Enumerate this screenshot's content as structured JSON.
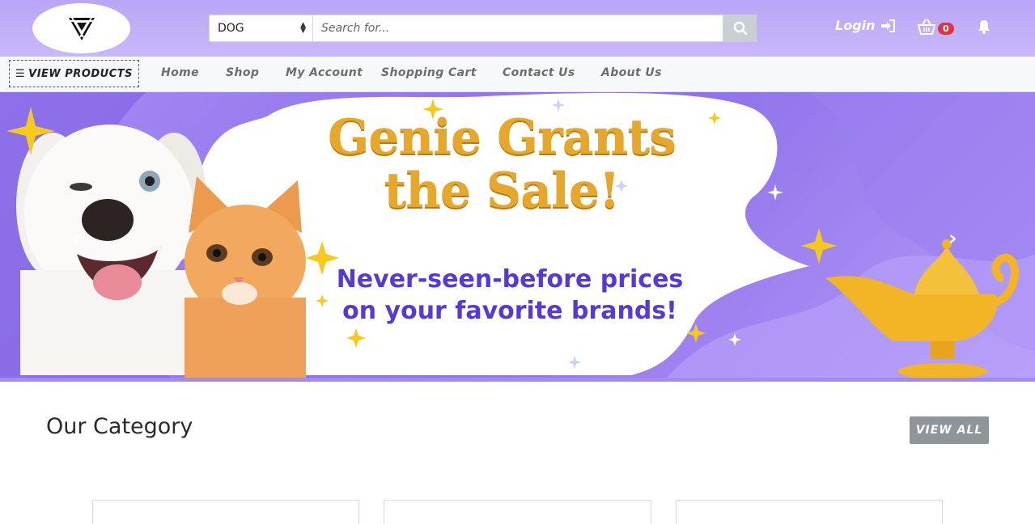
{
  "header": {
    "category_select": {
      "value": "DOG"
    },
    "search": {
      "placeholder": "Search for..."
    },
    "login_label": "Login",
    "cart_count": "0"
  },
  "nav": {
    "view_products_label": "VIEW PRODUCTS",
    "items": [
      {
        "label": "Home"
      },
      {
        "label": "Shop"
      },
      {
        "label": "My Account"
      },
      {
        "label": "Shopping Cart"
      },
      {
        "label": "Contact Us"
      },
      {
        "label": "About Us"
      }
    ]
  },
  "banner": {
    "headline": "Genie Grants the Sale!",
    "subtext_line1": "Never-seen-before prices",
    "subtext_line2": "on your favorite brands!"
  },
  "category_section": {
    "title": "Our Category",
    "view_all_label": "VIEW ALL"
  },
  "colors": {
    "header_bg": "#b9a6f7",
    "headline": "#e7a72a",
    "subtext": "#5639d6",
    "badge": "#dc3545"
  }
}
